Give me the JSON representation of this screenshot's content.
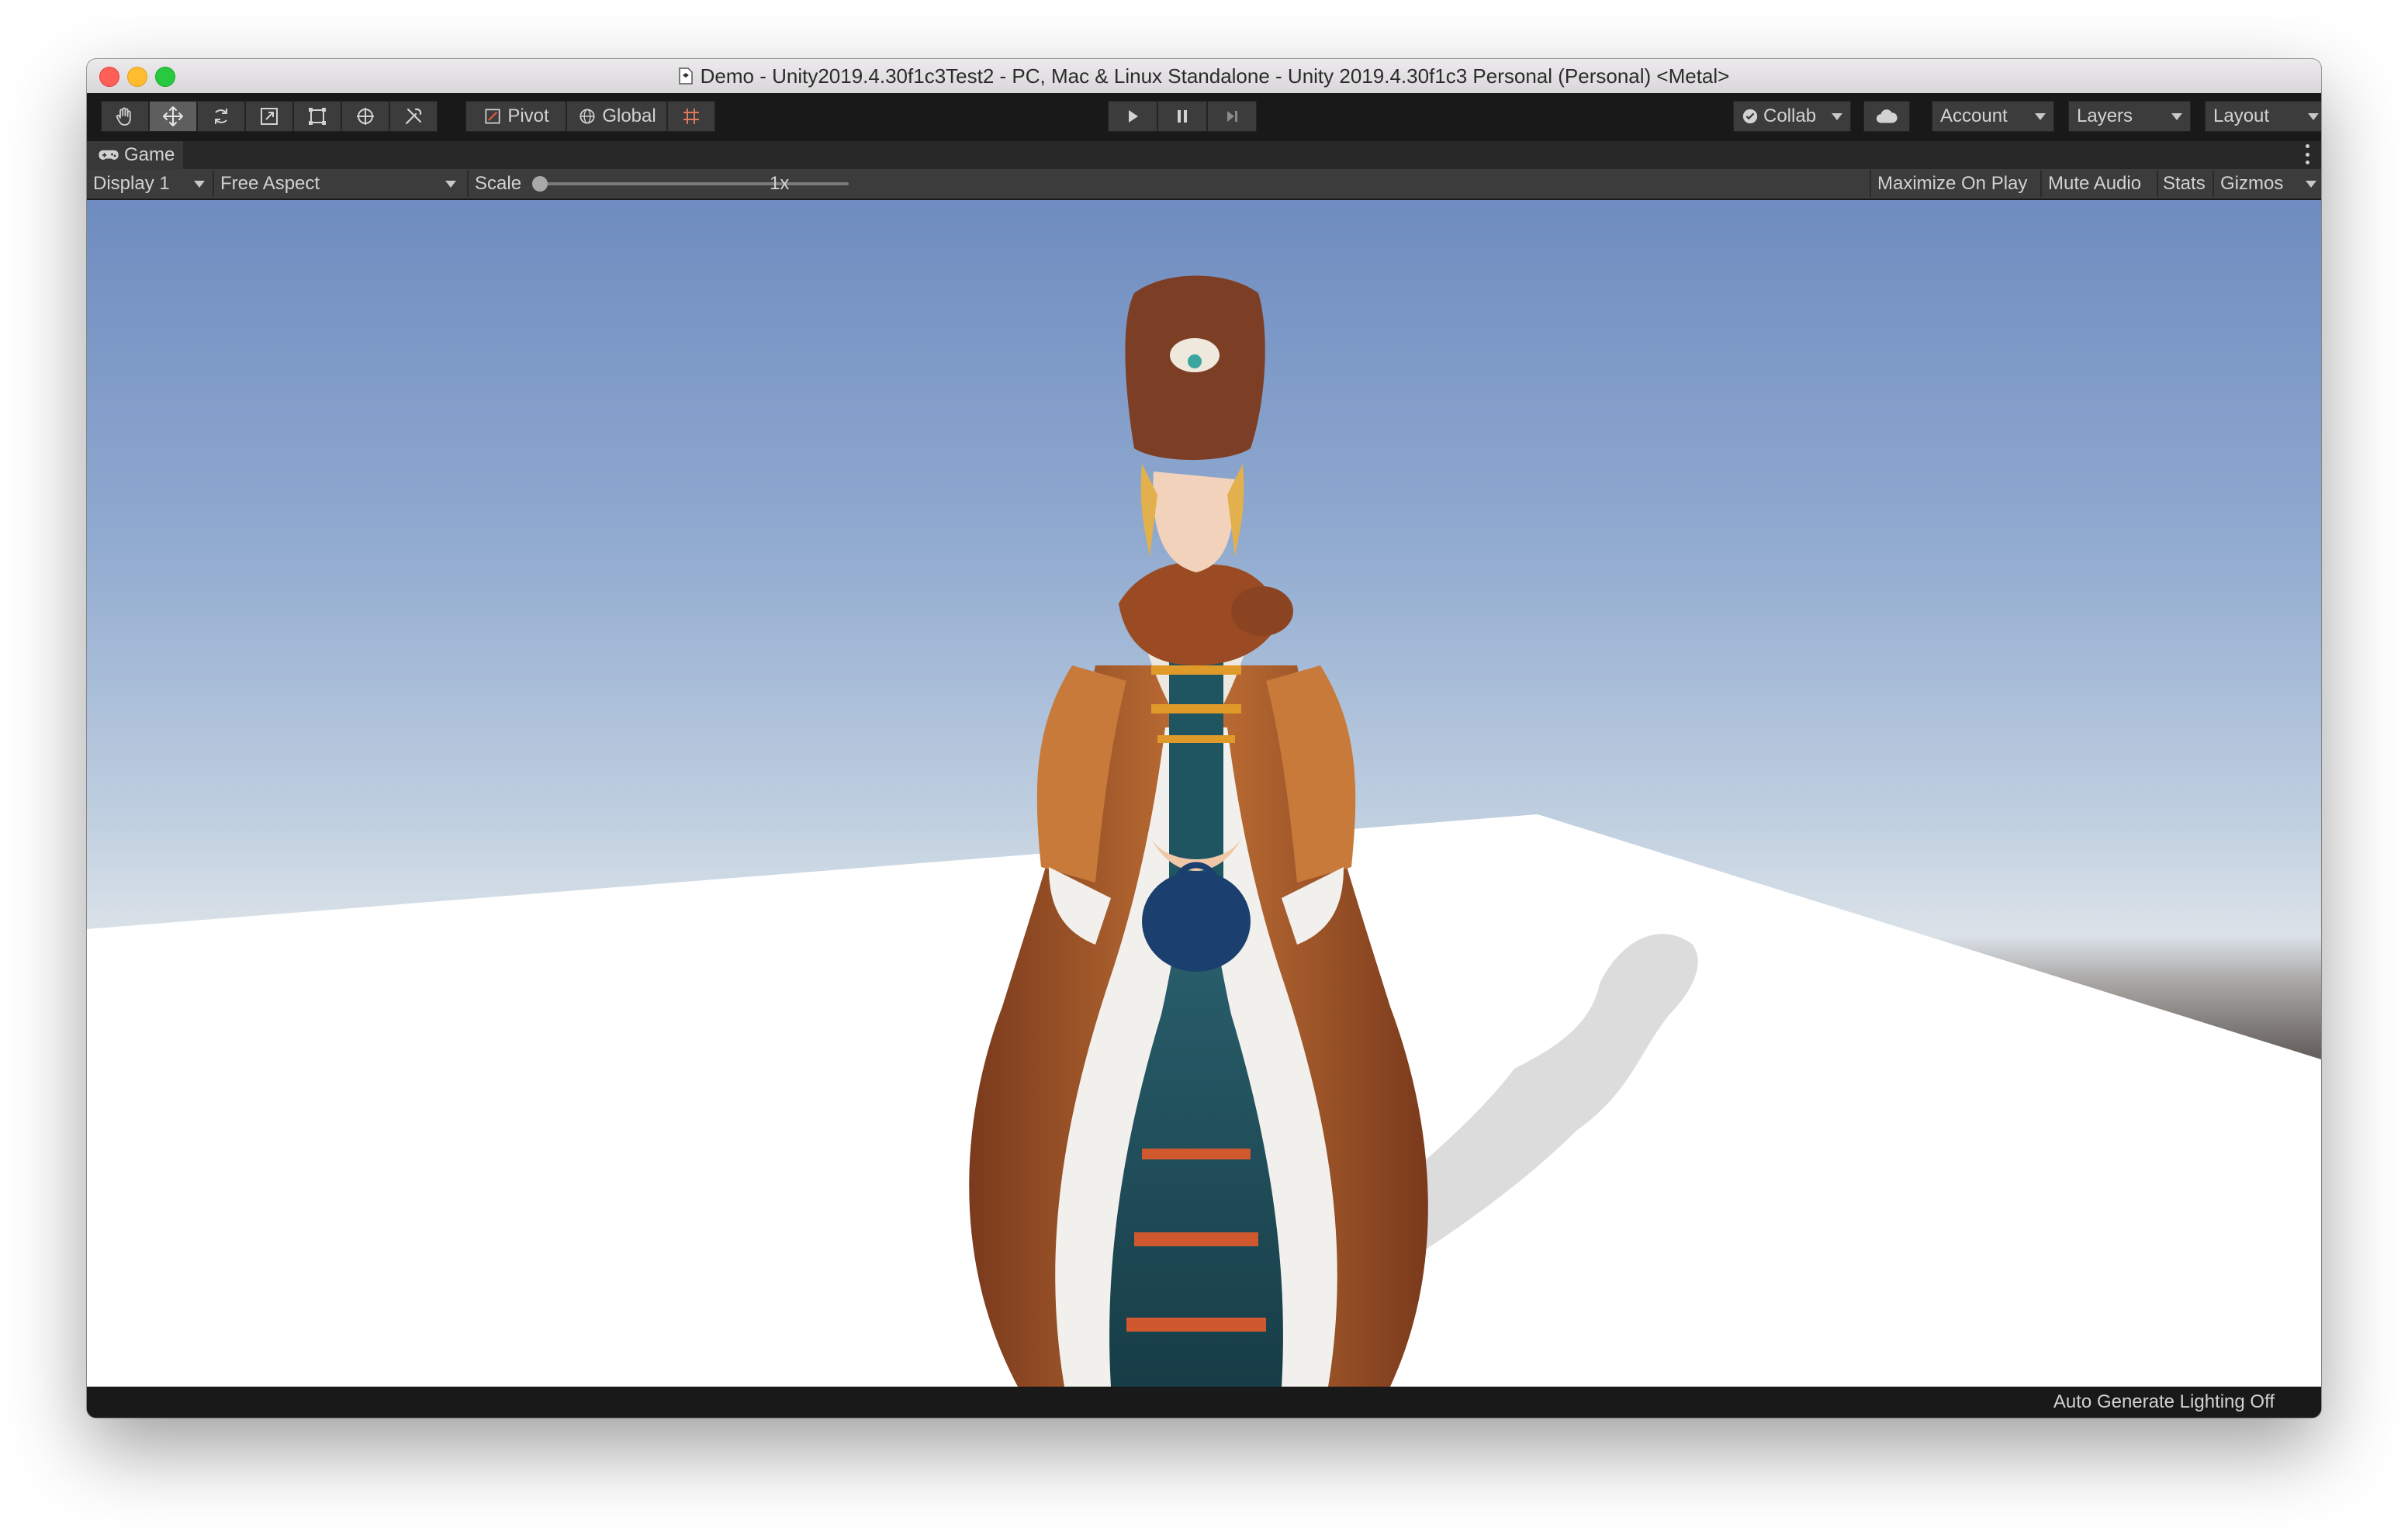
{
  "window": {
    "title": "Demo - Unity2019.4.30f1c3Test2 - PC, Mac & Linux Standalone - Unity 2019.4.30f1c3 Personal (Personal) <Metal>"
  },
  "toolbar": {
    "tools": [
      "hand-icon",
      "move-icon",
      "rotate-icon",
      "scale-icon",
      "rect-icon",
      "transform-icon",
      "custom-tool-icon"
    ],
    "active_tool": "move-icon",
    "pivot_label": "Pivot",
    "global_label": "Global",
    "snap_icon": "grid-snap-icon",
    "play_icons": [
      "play-icon",
      "pause-icon",
      "step-icon"
    ],
    "collab_label": "Collab",
    "cloud_icon": "cloud-icon",
    "account_label": "Account",
    "layers_label": "Layers",
    "layout_label": "Layout"
  },
  "panel": {
    "tab_label": "Game",
    "tab_icon": "gamepad-icon"
  },
  "gamebar": {
    "display": "Display 1",
    "aspect": "Free Aspect",
    "scale_label": "Scale",
    "scale_value": "1x",
    "scale_level": 0.0,
    "maximize_label": "Maximize On Play",
    "mute_label": "Mute Audio",
    "stats_label": "Stats",
    "gizmos_label": "Gizmos"
  },
  "status": {
    "lighting": "Auto Generate Lighting Off"
  },
  "colors": {
    "editor_dark": "#191919",
    "toolbar_button": "#3c3c3c",
    "sky_top": "#6f8cc0",
    "horizon": "#c7cfd6",
    "ground": "#5f5a57",
    "plane": "#ffffff"
  }
}
